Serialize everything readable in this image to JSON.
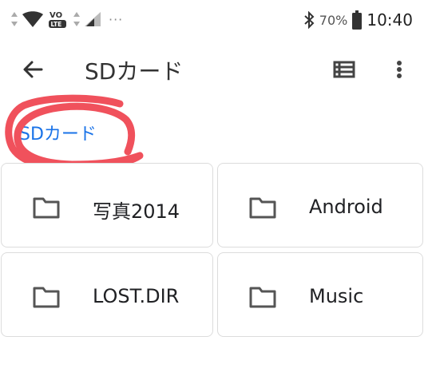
{
  "status_bar": {
    "volte_label": "VO",
    "lte_label": "LTE",
    "notification_dots": "···",
    "battery_percent": "70%",
    "time": "10:40"
  },
  "app_bar": {
    "title": "SDカード",
    "back_icon": "arrow-back-icon",
    "view_icon": "list-view-icon",
    "more_icon": "more-vert-icon"
  },
  "breadcrumb": {
    "label": "SDカード",
    "color": "#1a73e8"
  },
  "annotation": {
    "color": "#f0515c"
  },
  "folders": [
    {
      "name": "写真2014",
      "icon": "folder-icon"
    },
    {
      "name": "Android",
      "icon": "folder-icon"
    },
    {
      "name": "LOST.DIR",
      "icon": "folder-icon"
    },
    {
      "name": "Music",
      "icon": "folder-icon"
    }
  ]
}
